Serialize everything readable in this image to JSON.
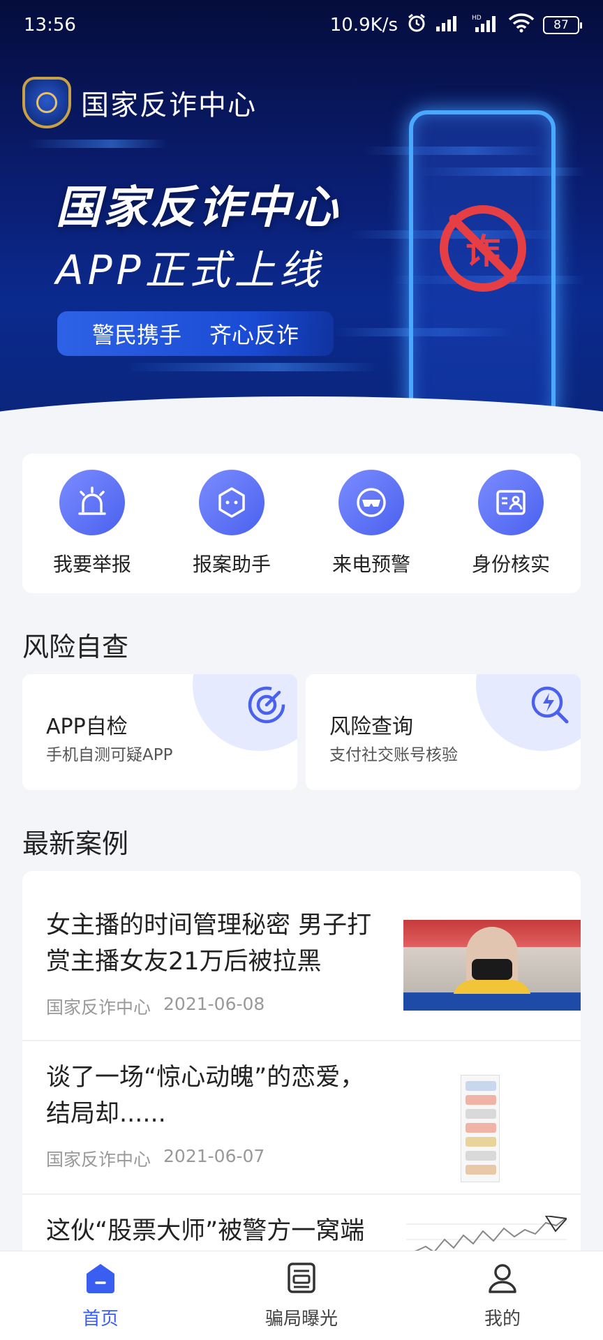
{
  "statusbar": {
    "time": "13:56",
    "net_speed": "10.9K/s",
    "battery": "87"
  },
  "hero": {
    "brand_name": "国家反诈中心",
    "title_main": "国家反诈中心",
    "title_sub": "APP正式上线",
    "slogan_left": "警民携手",
    "slogan_right": "齐心反诈",
    "phone_glyph": "诈"
  },
  "quick_actions": [
    {
      "label": "我要举报",
      "icon": "alarm-icon"
    },
    {
      "label": "报案助手",
      "icon": "robot-icon"
    },
    {
      "label": "来电预警",
      "icon": "mask-icon"
    },
    {
      "label": "身份核实",
      "icon": "id-card-icon"
    }
  ],
  "risk": {
    "section_title": "风险自查",
    "cards": [
      {
        "title": "APP自检",
        "subtitle": "手机自测可疑APP",
        "icon": "radar-icon"
      },
      {
        "title": "风险查询",
        "subtitle": "支付社交账号核验",
        "icon": "search-bolt-icon"
      }
    ]
  },
  "cases": {
    "section_title": "最新案例",
    "items": [
      {
        "title_line1": "女主播的时间管理秘密 男子打",
        "title_line2": "赏主播女友21万后被拉黑",
        "source": "国家反诈中心",
        "date": "2021-06-08"
      },
      {
        "title_line1": "谈了一场“惊心动魄”的恋爱，",
        "title_line2": "结局却......",
        "source": "国家反诈中心",
        "date": "2021-06-07"
      },
      {
        "title_line1": "这伙“股票大师”被警方一窝端",
        "title_line2": "",
        "source": "",
        "date": ""
      }
    ]
  },
  "tabbar": {
    "active_color": "#3a5ff0",
    "items": [
      {
        "label": "首页",
        "icon": "home-icon",
        "active": true
      },
      {
        "label": "骗局曝光",
        "icon": "news-icon",
        "active": false
      },
      {
        "label": "我的",
        "icon": "user-icon",
        "active": false
      }
    ]
  }
}
